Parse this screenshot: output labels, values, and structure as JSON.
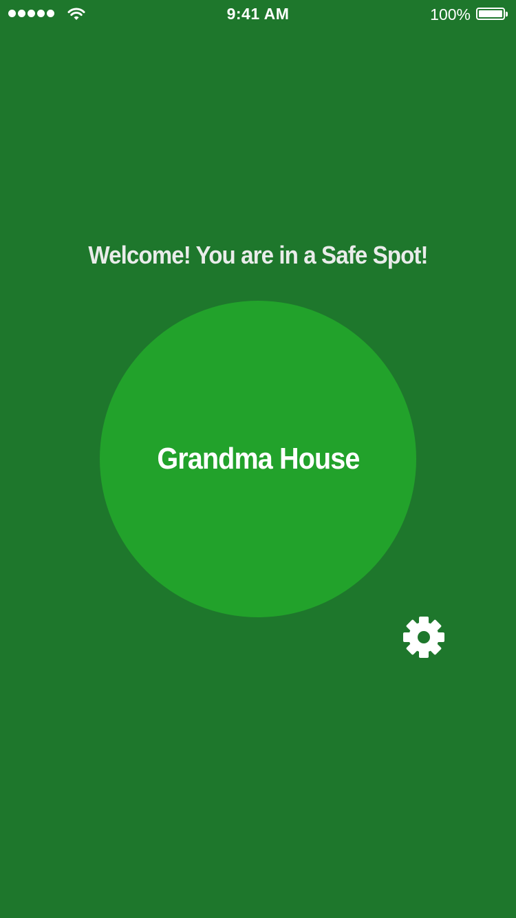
{
  "status_bar": {
    "time": "9:41 AM",
    "battery_percent": "100%",
    "signal_icon": "signal-dots-icon",
    "wifi_icon": "wifi-icon",
    "battery_icon": "battery-icon"
  },
  "main": {
    "welcome_text": "Welcome! You are in a Safe Spot!",
    "place_name": "Grandma House",
    "settings_icon": "gear-icon"
  },
  "colors": {
    "background": "#1e772c",
    "circle": "#22a22b",
    "text": "#ffffff"
  }
}
